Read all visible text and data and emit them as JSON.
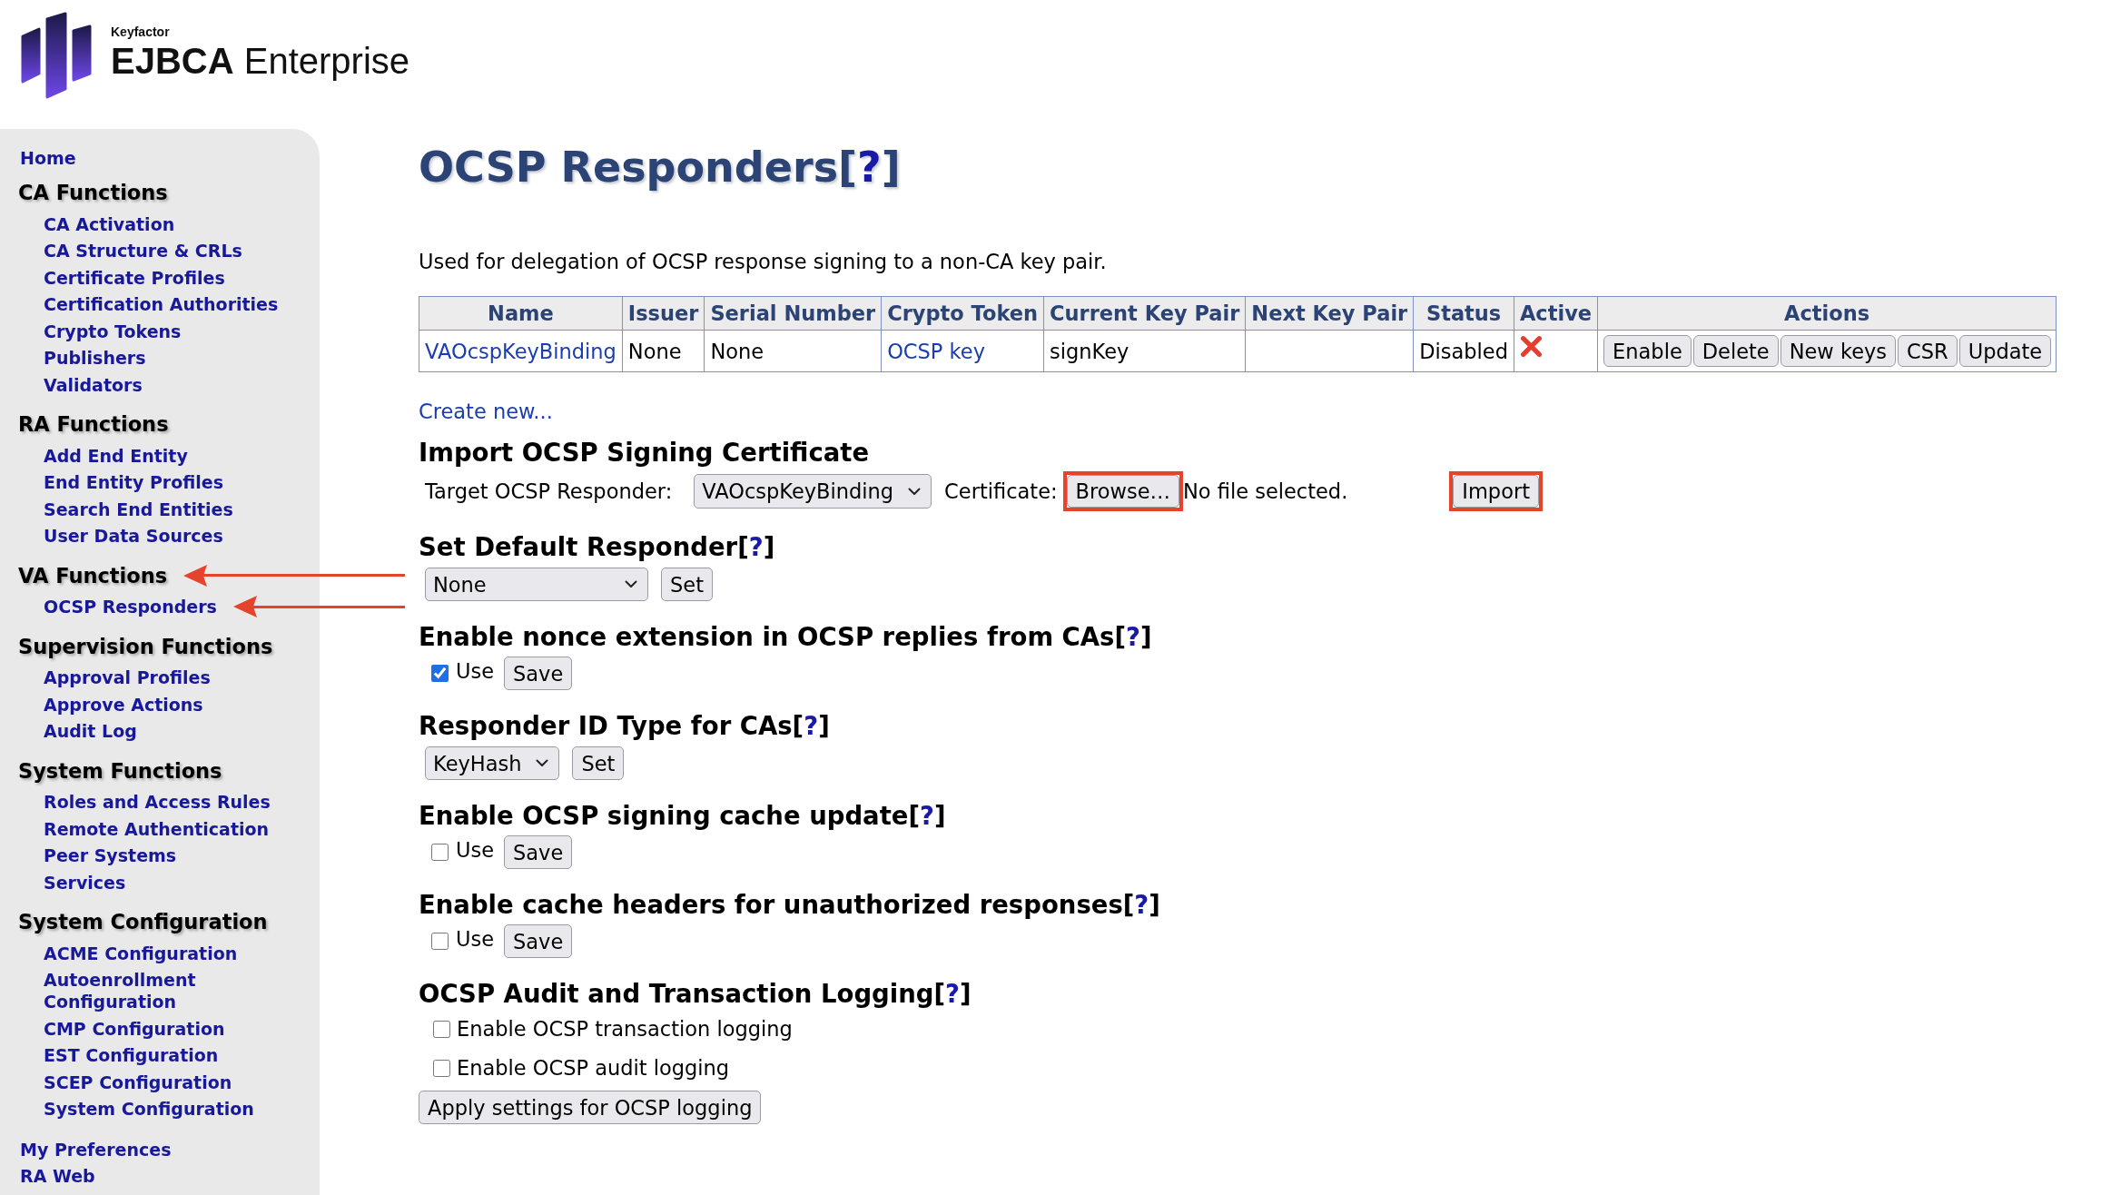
{
  "logo": {
    "company": "Keyfactor",
    "product": "**EJBCA** Enterprise"
  },
  "sidebar": {
    "top_links": [
      {
        "label": "Home",
        "arrow": false
      }
    ],
    "groups": [
      {
        "title": "CA Functions",
        "arrow": false,
        "items": [
          {
            "label": "CA Activation",
            "arrow": false
          },
          {
            "label": "CA Structure & CRLs",
            "arrow": false
          },
          {
            "label": "Certificate Profiles",
            "arrow": false
          },
          {
            "label": "Certification Authorities",
            "arrow": false
          },
          {
            "label": "Crypto Tokens",
            "arrow": false
          },
          {
            "label": "Publishers",
            "arrow": false
          },
          {
            "label": "Validators",
            "arrow": false
          }
        ]
      },
      {
        "title": "RA Functions",
        "arrow": false,
        "items": [
          {
            "label": "Add End Entity",
            "arrow": false
          },
          {
            "label": "End Entity Profiles",
            "arrow": false
          },
          {
            "label": "Search End Entities",
            "arrow": false
          },
          {
            "label": "User Data Sources",
            "arrow": false
          }
        ]
      },
      {
        "title": "VA Functions",
        "arrow": true,
        "items": [
          {
            "label": "OCSP Responders",
            "arrow": true
          }
        ]
      },
      {
        "title": "Supervision Functions",
        "arrow": false,
        "items": [
          {
            "label": "Approval Profiles",
            "arrow": false
          },
          {
            "label": "Approve Actions",
            "arrow": false
          },
          {
            "label": "Audit Log",
            "arrow": false
          }
        ]
      },
      {
        "title": "System Functions",
        "arrow": false,
        "items": [
          {
            "label": "Roles and Access Rules",
            "arrow": false
          },
          {
            "label": "Remote Authentication",
            "arrow": false
          },
          {
            "label": "Peer Systems",
            "arrow": false
          },
          {
            "label": "Services",
            "arrow": false
          }
        ]
      },
      {
        "title": "System Configuration",
        "arrow": false,
        "items": [
          {
            "label": "ACME Configuration",
            "arrow": false
          },
          {
            "label": "Autoenrollment Configuration",
            "arrow": false
          },
          {
            "label": "CMP Configuration",
            "arrow": false
          },
          {
            "label": "EST Configuration",
            "arrow": false
          },
          {
            "label": "SCEP Configuration",
            "arrow": false
          },
          {
            "label": "System Configuration",
            "arrow": false
          }
        ]
      }
    ],
    "bottom_links": [
      {
        "label": "My Preferences",
        "arrow": false
      },
      {
        "label": "RA Web",
        "arrow": false
      }
    ]
  },
  "page": {
    "title": "OCSP Responders[",
    "help_link": "?",
    "title_end": "]",
    "description": "Used for delegation of OCSP response signing to a non-CA key pair.",
    "table": {
      "columns": [
        "Name",
        "Issuer",
        "Serial Number",
        "Crypto Token",
        "Current Key Pair",
        "Next Key Pair",
        "Status",
        "Active",
        "Actions"
      ],
      "rows": [
        {
          "name": "VAOcspKeyBinding",
          "issuer": "None",
          "serial_number": "None",
          "crypto_token": "OCSP key",
          "current_key_pair": "signKey",
          "status": "Disabled",
          "active": false,
          "actions": [
            "Enable",
            "Delete",
            "New keys",
            "CSR",
            "Update"
          ]
        }
      ]
    },
    "create_link": "Create new...",
    "sections": [
      {
        "kind": "import",
        "heading": "Import OCSP Signing Certificate",
        "target_label": "Target OCSP Responder:",
        "target_value": "VAOcspKeyBinding",
        "certificate_label": "Certificate:",
        "browse_button": {
          "label": "Browse…",
          "highlighted": true
        },
        "file_status": "No file selected.",
        "import_button": {
          "label": "Import",
          "highlighted": true
        }
      },
      {
        "kind": "select",
        "heading": "Set Default Responder[",
        "help_link": "?",
        "heading_end": "]",
        "value": "None",
        "button": "Set"
      },
      {
        "kind": "toggle",
        "heading": "Enable nonce extension in OCSP replies from CAs[",
        "help_link": "?",
        "heading_end": "]",
        "checkbox_label": "Use",
        "checked": true,
        "button": "Save"
      },
      {
        "kind": "select",
        "heading": "Responder ID Type for CAs[",
        "help_link": "?",
        "heading_end": "]",
        "value": "KeyHash",
        "button": "Set"
      },
      {
        "kind": "toggle",
        "heading": "Enable OCSP signing cache update[",
        "help_link": "?",
        "heading_end": "]",
        "checkbox_label": "Use",
        "checked": false,
        "button": "Save"
      },
      {
        "kind": "toggle",
        "heading": "Enable cache headers for unauthorized responses[",
        "help_link": "?",
        "heading_end": "]",
        "checkbox_label": "Use",
        "checked": false,
        "button": "Save"
      },
      {
        "kind": "logging",
        "heading": "OCSP Audit and Transaction Logging[",
        "help_link": "?",
        "heading_end": "]",
        "options": [
          {
            "label": "Enable OCSP transaction logging",
            "checked": false
          },
          {
            "label": "Enable OCSP audit logging",
            "checked": false
          }
        ],
        "button": "Apply settings for OCSP logging"
      }
    ]
  }
}
